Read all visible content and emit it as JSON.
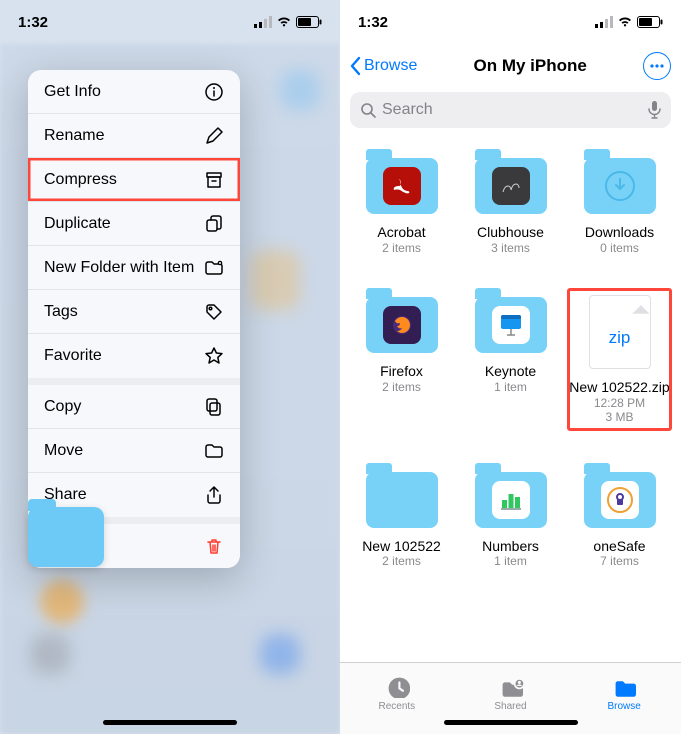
{
  "status": {
    "time": "1:32"
  },
  "ctx": {
    "items": [
      {
        "label": "Get Info",
        "icon": "info",
        "group": 0
      },
      {
        "label": "Rename",
        "icon": "pencil",
        "group": 0
      },
      {
        "label": "Compress",
        "icon": "archive",
        "group": 0,
        "highlighted": true
      },
      {
        "label": "Duplicate",
        "icon": "duplicate",
        "group": 0
      },
      {
        "label": "New Folder with Item",
        "icon": "newfolder",
        "group": 0
      },
      {
        "label": "Tags",
        "icon": "tag",
        "group": 0
      },
      {
        "label": "Favorite",
        "icon": "star",
        "group": 0
      },
      {
        "label": "Copy",
        "icon": "copy",
        "group": 1
      },
      {
        "label": "Move",
        "icon": "folder",
        "group": 1
      },
      {
        "label": "Share",
        "icon": "share",
        "group": 1
      },
      {
        "label": "Delete",
        "icon": "trash",
        "group": 2,
        "delete": true
      }
    ]
  },
  "right": {
    "back": "Browse",
    "title": "On My iPhone",
    "search_placeholder": "Search",
    "tiles": [
      {
        "type": "folder",
        "name": "Acrobat",
        "meta": "2 items",
        "app": "acrobat"
      },
      {
        "type": "folder",
        "name": "Clubhouse",
        "meta": "3 items",
        "app": "clubhouse"
      },
      {
        "type": "folder",
        "name": "Downloads",
        "meta": "0 items",
        "app": "download"
      },
      {
        "type": "folder",
        "name": "Firefox",
        "meta": "2 items",
        "app": "firefox"
      },
      {
        "type": "folder",
        "name": "Keynote",
        "meta": "1 item",
        "app": "keynote"
      },
      {
        "type": "zip",
        "name": "New 102522.zip",
        "meta": "12:28 PM",
        "meta2": "3 MB",
        "highlighted": true
      },
      {
        "type": "folder",
        "name": "New 102522",
        "meta": "2 items",
        "app": ""
      },
      {
        "type": "folder",
        "name": "Numbers",
        "meta": "1 item",
        "app": "numbers"
      },
      {
        "type": "folder",
        "name": "oneSafe",
        "meta": "7 items",
        "app": "onesafe"
      }
    ],
    "tabs": [
      {
        "label": "Recents",
        "icon": "clock",
        "active": false
      },
      {
        "label": "Shared",
        "icon": "shared",
        "active": false
      },
      {
        "label": "Browse",
        "icon": "browse",
        "active": true
      }
    ]
  }
}
